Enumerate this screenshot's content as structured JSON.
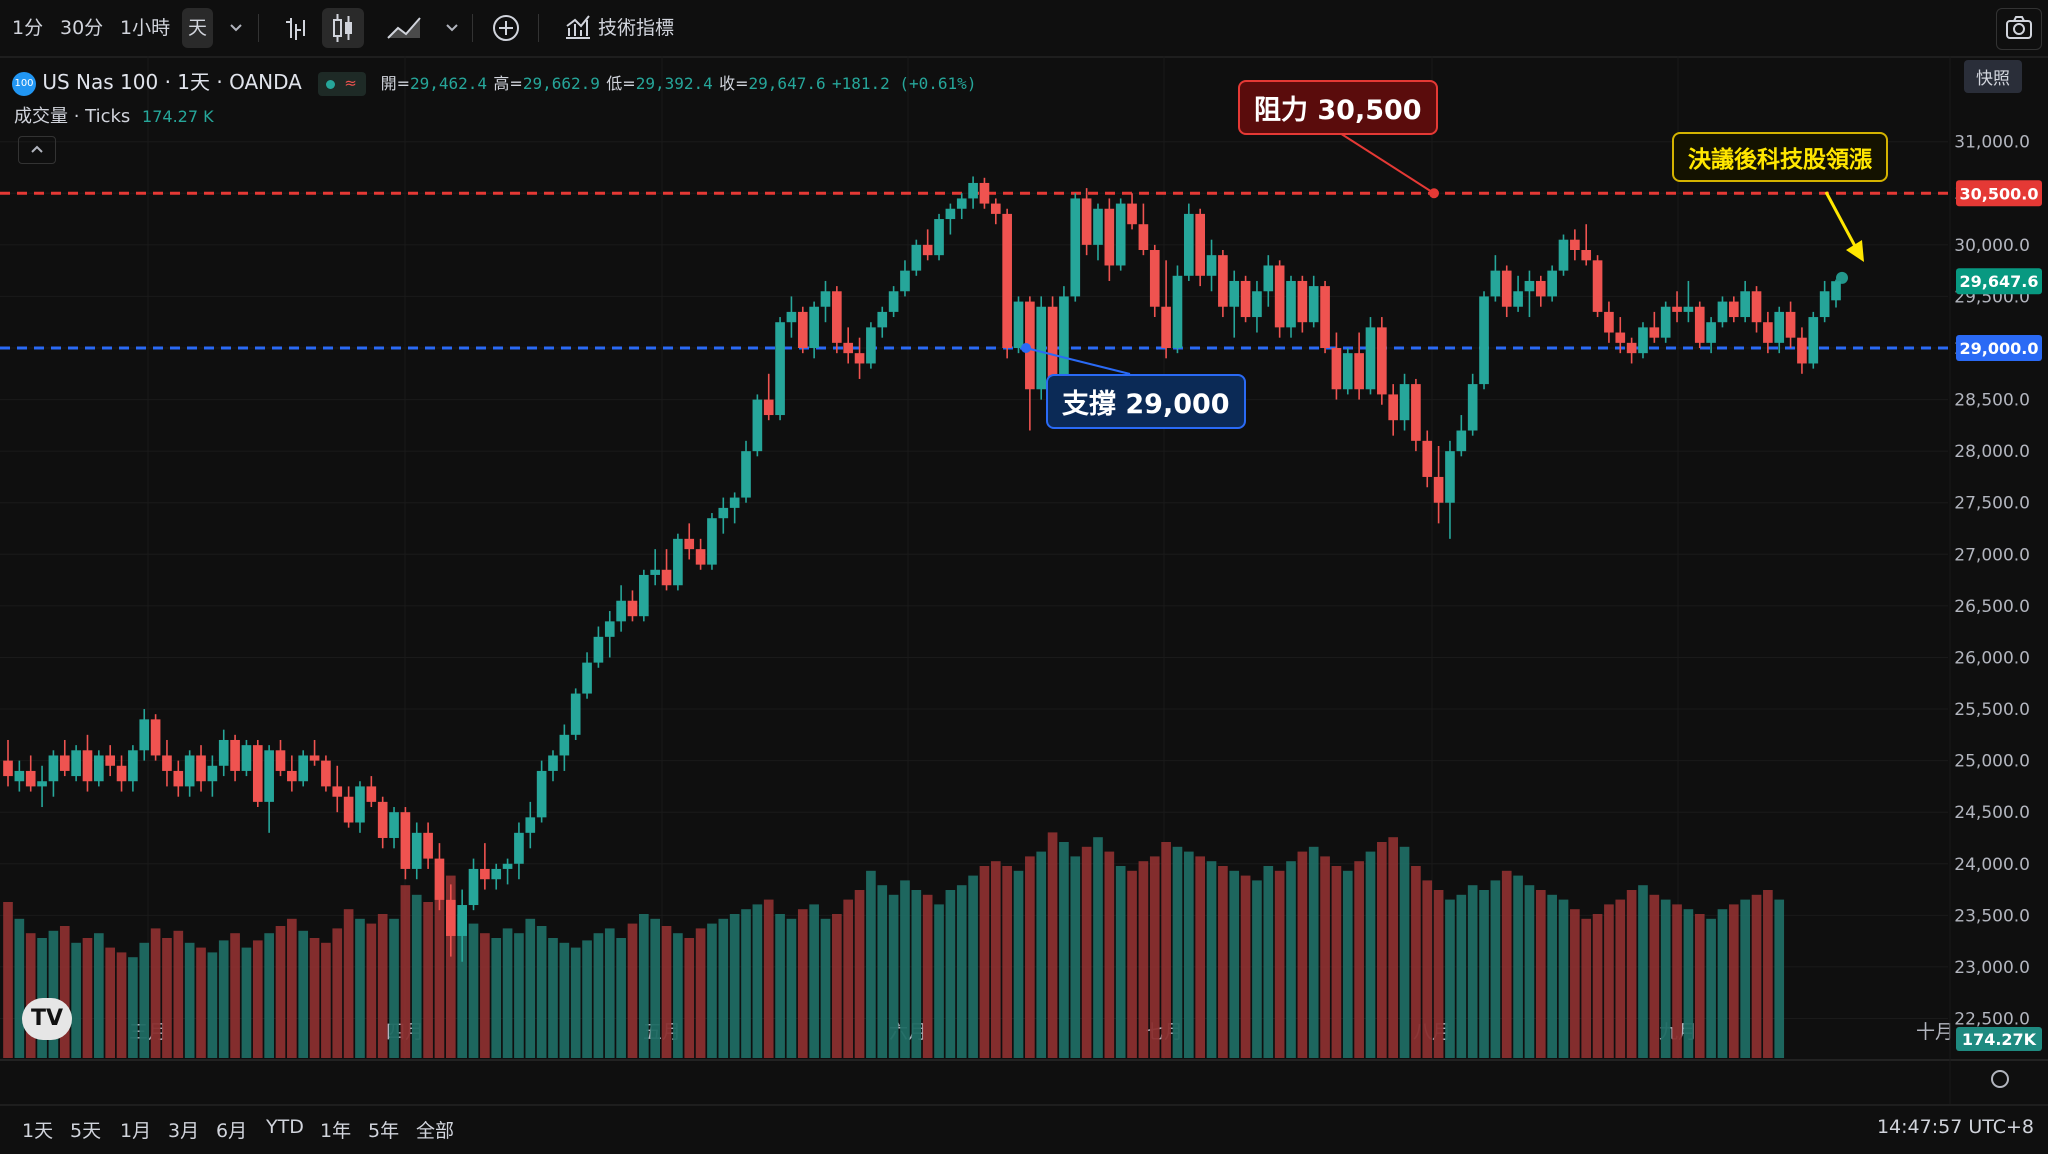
{
  "toolbar": {
    "intervals": [
      "1分",
      "30分",
      "1小時",
      "天"
    ],
    "active_interval": "天",
    "indicators_label": "技術指標"
  },
  "snapshot_tooltip": "快照",
  "legend": {
    "symbol": "US Nas 100 · 1天 · OANDA",
    "badge": "100",
    "open_label": "開=",
    "open": "29,462.4",
    "high_label": "高=",
    "high": "29,662.9",
    "low_label": "低=",
    "low": "29,392.4",
    "close_label": "收=",
    "close": "29,647.6",
    "change": "+181.2 (+0.61%)",
    "volume_label": "成交量 · Ticks",
    "volume_value": "174.27 K"
  },
  "bottom": {
    "ranges": [
      "1天",
      "5天",
      "1月",
      "3月",
      "6月",
      "YTD",
      "1年",
      "5年",
      "全部"
    ],
    "clock": "14:47:57 UTC+8"
  },
  "colors": {
    "up": "#26a69a",
    "down": "#ef5350",
    "resistance": "#e53935",
    "support": "#2a6af5",
    "note": "#ffe600"
  },
  "chart_data": {
    "type": "candlestick",
    "symbol": "US Nas 100",
    "interval": "1天",
    "y_axis_labels": [
      "22,500.0",
      "23,000.0",
      "23,500.0",
      "24,000.0",
      "24,500.0",
      "25,000.0",
      "25,500.0",
      "26,000.0",
      "26,500.0",
      "27,000.0",
      "27,500.0",
      "28,000.0",
      "28,500.0",
      "29,000.0",
      "29,500.0",
      "30,000.0",
      "30,500.0",
      "31,000.0"
    ],
    "ylim": [
      22340,
      31220
    ],
    "x_axis_labels": [
      "三月",
      "四月",
      "五月",
      "六月",
      "七月",
      "八月",
      "九月",
      "十月"
    ],
    "price_tags": [
      {
        "label": "30,500.0",
        "value": 30500,
        "color": "#e53935"
      },
      {
        "label": "29,647.6",
        "value": 29647.6,
        "color": "#089981"
      },
      {
        "label": "29,000.0",
        "value": 29000,
        "color": "#2a6af5"
      }
    ],
    "volume_tag": "174.27K",
    "annotations": {
      "resistance": {
        "label": "阻力 30,500",
        "value": 30500
      },
      "support": {
        "label": "支撐 29,000",
        "value": 29000
      },
      "note": "決議後科技股領漲"
    },
    "ohlc": [
      [
        25000,
        25200,
        24750,
        24850
      ],
      [
        24800,
        25000,
        24700,
        24900
      ],
      [
        24900,
        25050,
        24700,
        24750
      ],
      [
        24750,
        24950,
        24550,
        24800
      ],
      [
        24800,
        25100,
        24650,
        25050
      ],
      [
        25050,
        25200,
        24850,
        24900
      ],
      [
        24850,
        25150,
        24800,
        25100
      ],
      [
        25100,
        25250,
        24700,
        24800
      ],
      [
        24800,
        25100,
        24750,
        25050
      ],
      [
        25050,
        25150,
        24850,
        24950
      ],
      [
        24950,
        25050,
        24700,
        24800
      ],
      [
        24800,
        25150,
        24700,
        25100
      ],
      [
        25100,
        25500,
        25000,
        25400
      ],
      [
        25400,
        25450,
        25000,
        25050
      ],
      [
        25050,
        25200,
        24750,
        24900
      ],
      [
        24900,
        25000,
        24650,
        24750
      ],
      [
        24750,
        25100,
        24650,
        25050
      ],
      [
        25050,
        25150,
        24700,
        24800
      ],
      [
        24800,
        25050,
        24650,
        24950
      ],
      [
        24950,
        25300,
        24850,
        25200
      ],
      [
        25200,
        25250,
        24800,
        24900
      ],
      [
        24900,
        25200,
        24850,
        25150
      ],
      [
        25150,
        25200,
        24550,
        24600
      ],
      [
        24600,
        25150,
        24300,
        25100
      ],
      [
        25100,
        25200,
        24850,
        24900
      ],
      [
        24900,
        25050,
        24700,
        24800
      ],
      [
        24800,
        25100,
        24750,
        25050
      ],
      [
        25050,
        25200,
        24950,
        25000
      ],
      [
        25000,
        25050,
        24700,
        24750
      ],
      [
        24750,
        24950,
        24500,
        24650
      ],
      [
        24650,
        24750,
        24350,
        24400
      ],
      [
        24400,
        24800,
        24300,
        24750
      ],
      [
        24750,
        24850,
        24550,
        24600
      ],
      [
        24600,
        24650,
        24150,
        24250
      ],
      [
        24250,
        24550,
        24150,
        24500
      ],
      [
        24500,
        24550,
        23850,
        23950
      ],
      [
        23950,
        24400,
        23850,
        24300
      ],
      [
        24300,
        24400,
        23950,
        24050
      ],
      [
        24050,
        24200,
        23550,
        23650
      ],
      [
        23650,
        23800,
        23100,
        23300
      ],
      [
        23300,
        23750,
        23050,
        23600
      ],
      [
        23600,
        24050,
        23550,
        23950
      ],
      [
        23950,
        24200,
        23750,
        23850
      ],
      [
        23850,
        24000,
        23750,
        23950
      ],
      [
        23950,
        24050,
        23800,
        24000
      ],
      [
        24000,
        24400,
        23850,
        24300
      ],
      [
        24300,
        24600,
        24150,
        24450
      ],
      [
        24450,
        25000,
        24400,
        24900
      ],
      [
        24900,
        25100,
        24800,
        25050
      ],
      [
        25050,
        25350,
        24900,
        25250
      ],
      [
        25250,
        25700,
        25200,
        25650
      ],
      [
        25650,
        26050,
        25600,
        25950
      ],
      [
        25950,
        26300,
        25900,
        26200
      ],
      [
        26200,
        26450,
        26000,
        26350
      ],
      [
        26350,
        26700,
        26250,
        26550
      ],
      [
        26550,
        26650,
        26350,
        26400
      ],
      [
        26400,
        26850,
        26350,
        26800
      ],
      [
        26800,
        27050,
        26700,
        26850
      ],
      [
        26850,
        27050,
        26650,
        26700
      ],
      [
        26700,
        27200,
        26650,
        27150
      ],
      [
        27150,
        27300,
        26950,
        27050
      ],
      [
        27050,
        27150,
        26850,
        26900
      ],
      [
        26900,
        27400,
        26850,
        27350
      ],
      [
        27350,
        27550,
        27200,
        27450
      ],
      [
        27450,
        27600,
        27300,
        27550
      ],
      [
        27550,
        28100,
        27500,
        28000
      ],
      [
        28000,
        28550,
        27950,
        28500
      ],
      [
        28500,
        28750,
        28300,
        28350
      ],
      [
        28350,
        29300,
        28300,
        29250
      ],
      [
        29250,
        29500,
        29100,
        29350
      ],
      [
        29350,
        29400,
        28950,
        29000
      ],
      [
        29000,
        29450,
        28900,
        29400
      ],
      [
        29400,
        29650,
        29250,
        29550
      ],
      [
        29550,
        29600,
        28950,
        29050
      ],
      [
        29050,
        29200,
        28850,
        28950
      ],
      [
        28950,
        29100,
        28700,
        28850
      ],
      [
        28850,
        29250,
        28800,
        29200
      ],
      [
        29200,
        29400,
        29100,
        29350
      ],
      [
        29350,
        29600,
        29300,
        29550
      ],
      [
        29550,
        29850,
        29500,
        29750
      ],
      [
        29750,
        30050,
        29700,
        30000
      ],
      [
        30000,
        30150,
        29850,
        29900
      ],
      [
        29900,
        30300,
        29850,
        30250
      ],
      [
        30250,
        30400,
        30100,
        30350
      ],
      [
        30350,
        30500,
        30250,
        30450
      ],
      [
        30450,
        30663,
        30350,
        30600
      ],
      [
        30600,
        30650,
        30350,
        30400
      ],
      [
        30400,
        30450,
        30200,
        30300
      ],
      [
        30300,
        30350,
        28900,
        29000
      ],
      [
        29000,
        29500,
        28950,
        29450
      ],
      [
        29450,
        29500,
        28200,
        28600
      ],
      [
        28600,
        29500,
        28500,
        29400
      ],
      [
        29400,
        29500,
        28250,
        28400
      ],
      [
        28400,
        29600,
        28300,
        29500
      ],
      [
        29500,
        30500,
        29450,
        30450
      ],
      [
        30450,
        30550,
        29900,
        30000
      ],
      [
        30000,
        30400,
        29850,
        30350
      ],
      [
        30350,
        30450,
        29650,
        29800
      ],
      [
        29800,
        30450,
        29750,
        30400
      ],
      [
        30400,
        30500,
        30150,
        30200
      ],
      [
        30200,
        30400,
        29900,
        29950
      ],
      [
        29950,
        30000,
        29300,
        29400
      ],
      [
        29400,
        29850,
        28900,
        29000
      ],
      [
        29000,
        29800,
        28950,
        29700
      ],
      [
        29700,
        30400,
        29650,
        30300
      ],
      [
        30300,
        30350,
        29600,
        29700
      ],
      [
        29700,
        30050,
        29550,
        29900
      ],
      [
        29900,
        29950,
        29300,
        29400
      ],
      [
        29400,
        29750,
        29100,
        29650
      ],
      [
        29650,
        29700,
        29250,
        29300
      ],
      [
        29300,
        29650,
        29150,
        29550
      ],
      [
        29550,
        29900,
        29400,
        29800
      ],
      [
        29800,
        29850,
        29100,
        29200
      ],
      [
        29200,
        29700,
        29100,
        29650
      ],
      [
        29650,
        29700,
        29150,
        29250
      ],
      [
        29250,
        29700,
        29200,
        29600
      ],
      [
        29600,
        29650,
        28950,
        29000
      ],
      [
        29000,
        29150,
        28500,
        28600
      ],
      [
        28600,
        29000,
        28550,
        28950
      ],
      [
        28950,
        29150,
        28500,
        28600
      ],
      [
        28600,
        29300,
        28550,
        29200
      ],
      [
        29200,
        29300,
        28450,
        28550
      ],
      [
        28550,
        28650,
        28150,
        28300
      ],
      [
        28300,
        28750,
        28200,
        28650
      ],
      [
        28650,
        28700,
        28000,
        28100
      ],
      [
        28100,
        28200,
        27650,
        27750
      ],
      [
        27750,
        28050,
        27300,
        27500
      ],
      [
        27500,
        28100,
        27150,
        28000
      ],
      [
        28000,
        28350,
        27950,
        28200
      ],
      [
        28200,
        28750,
        28150,
        28650
      ],
      [
        28650,
        29550,
        28600,
        29500
      ],
      [
        29500,
        29900,
        29450,
        29750
      ],
      [
        29750,
        29800,
        29300,
        29400
      ],
      [
        29400,
        29700,
        29350,
        29550
      ],
      [
        29550,
        29750,
        29300,
        29650
      ],
      [
        29650,
        29700,
        29400,
        29500
      ],
      [
        29500,
        29800,
        29450,
        29750
      ],
      [
        29750,
        30100,
        29700,
        30050
      ],
      [
        30050,
        30150,
        29850,
        29950
      ],
      [
        29950,
        30200,
        29800,
        29850
      ],
      [
        29850,
        29900,
        29300,
        29350
      ],
      [
        29350,
        29450,
        29050,
        29150
      ],
      [
        29150,
        29300,
        28950,
        29050
      ],
      [
        29050,
        29100,
        28850,
        28950
      ],
      [
        28950,
        29250,
        28900,
        29200
      ],
      [
        29200,
        29350,
        29050,
        29100
      ],
      [
        29100,
        29450,
        29050,
        29400
      ],
      [
        29400,
        29550,
        29250,
        29350
      ],
      [
        29350,
        29650,
        29250,
        29400
      ],
      [
        29400,
        29450,
        29000,
        29050
      ],
      [
        29050,
        29300,
        28950,
        29250
      ],
      [
        29250,
        29500,
        29200,
        29450
      ],
      [
        29450,
        29500,
        29250,
        29300
      ],
      [
        29300,
        29650,
        29250,
        29550
      ],
      [
        29550,
        29600,
        29150,
        29250
      ],
      [
        29250,
        29350,
        28950,
        29050
      ],
      [
        29050,
        29400,
        28950,
        29350
      ],
      [
        29350,
        29450,
        29000,
        29100
      ],
      [
        29100,
        29200,
        28750,
        28850
      ],
      [
        28850,
        29350,
        28800,
        29300
      ],
      [
        29300,
        29650,
        29250,
        29550
      ],
      [
        29462.4,
        29662.9,
        29392.4,
        29647.6
      ]
    ],
    "volume": [
      65,
      58,
      52,
      50,
      53,
      55,
      48,
      50,
      52,
      46,
      44,
      42,
      48,
      54,
      50,
      53,
      48,
      46,
      44,
      49,
      52,
      46,
      49,
      52,
      55,
      58,
      53,
      50,
      48,
      54,
      62,
      58,
      56,
      60,
      58,
      72,
      68,
      65,
      70,
      76,
      60,
      56,
      52,
      50,
      54,
      52,
      58,
      55,
      50,
      48,
      46,
      49,
      52,
      54,
      50,
      56,
      60,
      58,
      55,
      52,
      50,
      54,
      56,
      58,
      60,
      62,
      64,
      66,
      60,
      58,
      62,
      64,
      58,
      60,
      66,
      70,
      78,
      72,
      68,
      74,
      70,
      68,
      64,
      70,
      72,
      76,
      80,
      82,
      80,
      78,
      84,
      86,
      94,
      90,
      84,
      88,
      92,
      86,
      80,
      78,
      82,
      84,
      90,
      88,
      86,
      84,
      82,
      80,
      78,
      76,
      74,
      80,
      78,
      82,
      86,
      88,
      84,
      80,
      78,
      82,
      86,
      90,
      92,
      88,
      80,
      74,
      70,
      66,
      68,
      72,
      70,
      74,
      78,
      76,
      72,
      70,
      68,
      66,
      62,
      58,
      60,
      64,
      66,
      70,
      72,
      68,
      66,
      64,
      62,
      60,
      58,
      62,
      64,
      66,
      68,
      70,
      66
    ]
  }
}
